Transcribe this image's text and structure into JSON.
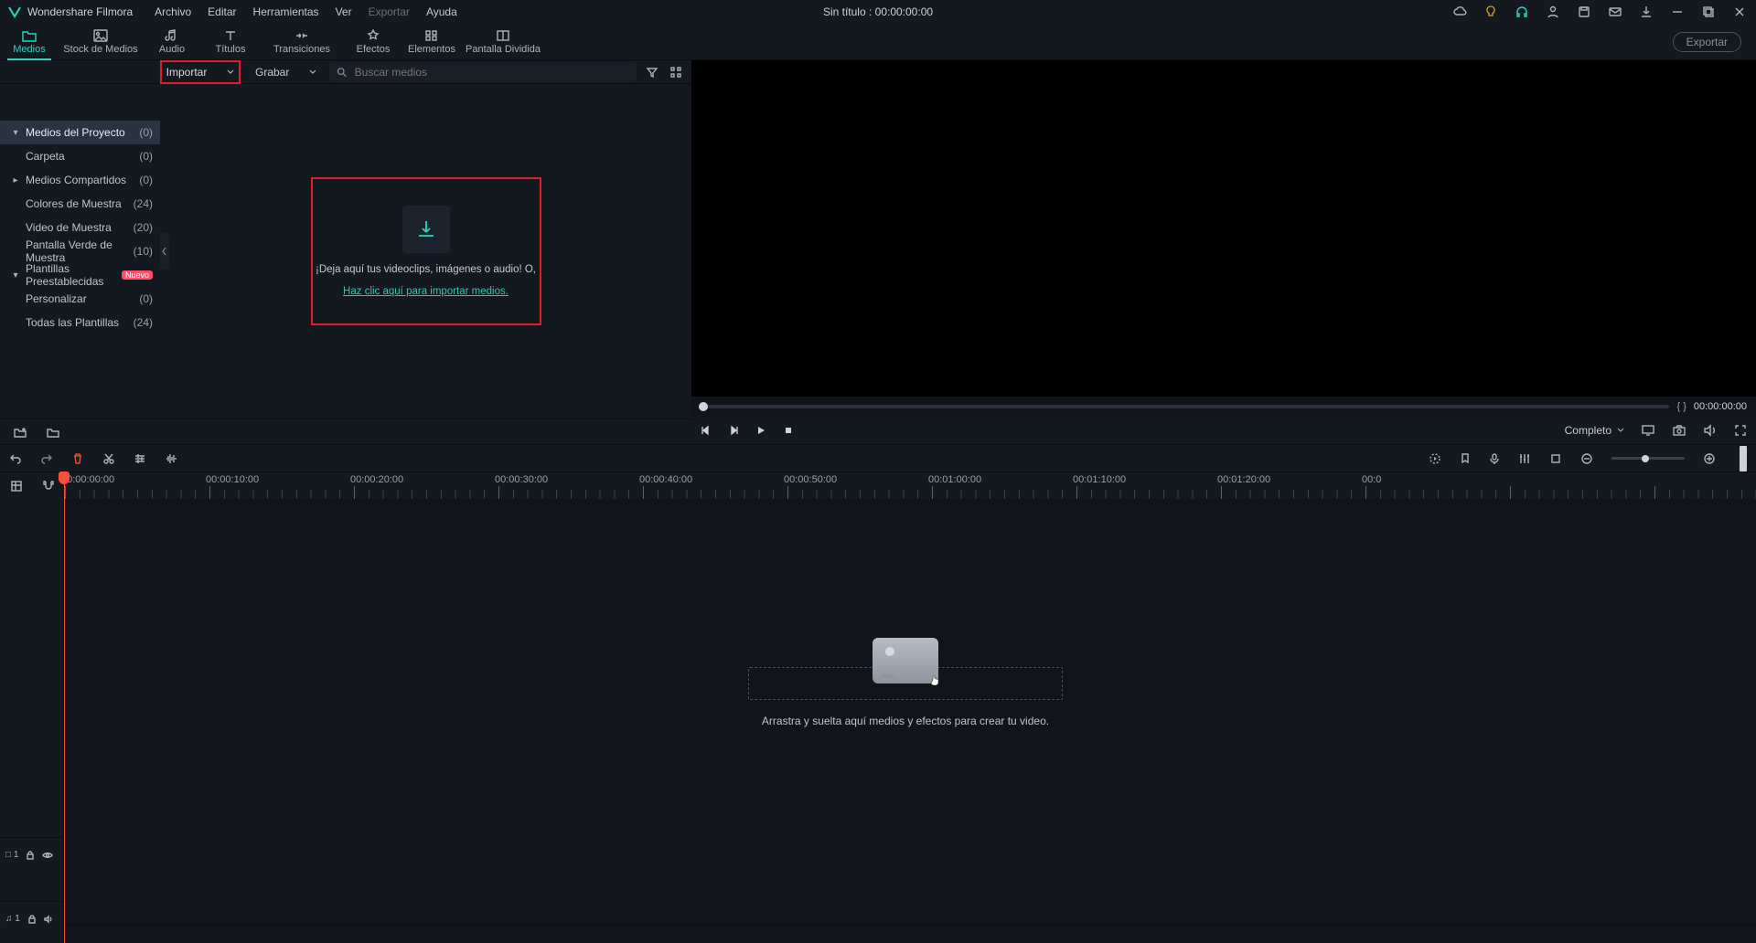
{
  "app": {
    "name": "Wondershare Filmora",
    "title_center": "Sin título : 00:00:00:00"
  },
  "menu": [
    "Archivo",
    "Editar",
    "Herramientas",
    "Ver",
    "Exportar",
    "Ayuda"
  ],
  "menu_disabled_index": 4,
  "tabs": [
    {
      "label": "Medios",
      "icon": "folder"
    },
    {
      "label": "Stock de Medios",
      "icon": "image"
    },
    {
      "label": "Audio",
      "icon": "music"
    },
    {
      "label": "Títulos",
      "icon": "text"
    },
    {
      "label": "Transiciones",
      "icon": "transition"
    },
    {
      "label": "Efectos",
      "icon": "sparkle"
    },
    {
      "label": "Elementos",
      "icon": "elements"
    },
    {
      "label": "Pantalla Dividida",
      "icon": "split"
    }
  ],
  "tabs_active_index": 0,
  "export_btn": "Exportar",
  "subbar": {
    "import_label": "Importar",
    "record_label": "Grabar",
    "search_placeholder": "Buscar medios"
  },
  "sidebar": [
    {
      "label": "Medios del Proyecto",
      "count": "(0)",
      "expand": "down",
      "selected": true
    },
    {
      "label": "Carpeta",
      "count": "(0)",
      "child": true
    },
    {
      "label": "Medios Compartidos",
      "count": "(0)",
      "expand": "right"
    },
    {
      "label": "Colores de Muestra",
      "count": "(24)",
      "child": true
    },
    {
      "label": "Video de Muestra",
      "count": "(20)",
      "child": true
    },
    {
      "label": "Pantalla Verde de Muestra",
      "count": "(10)",
      "child": true
    },
    {
      "label": "Plantillas Preestablecidas",
      "badge": "Nuevo",
      "expand": "down"
    },
    {
      "label": "Personalizar",
      "count": "(0)",
      "child": true
    },
    {
      "label": "Todas las Plantillas",
      "count": "(24)",
      "child": true
    }
  ],
  "drop": {
    "line1": "¡Deja aquí tus videoclips, imágenes o audio!  O,",
    "line2": "Haz clic aquí para importar medios."
  },
  "preview": {
    "time_braces": "{    }",
    "time_current": "00:00:00:00",
    "quality_label": "Completo"
  },
  "ruler_labels": [
    "00:00:00:00",
    "00:00:10:00",
    "00:00:20:00",
    "00:00:30:00",
    "00:00:40:00",
    "00:00:50:00",
    "00:01:00:00",
    "00:01:10:00",
    "00:01:20:00",
    "00:0"
  ],
  "timeline_hint": "Arrastra y suelta aquí medios y efectos para crear tu video.",
  "track_labels": {
    "video": "□ 1",
    "audio": "♫ 1"
  }
}
